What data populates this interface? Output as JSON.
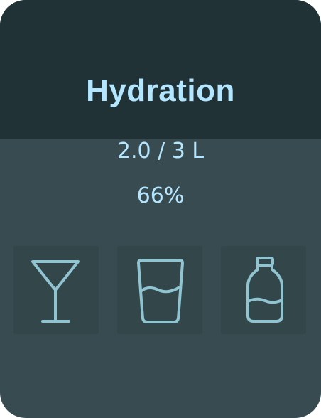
{
  "card": {
    "title": "Hydration",
    "amount": "2.0 / 3 L",
    "percent_text": "66%",
    "progress_fraction": 0.66
  },
  "drinks": [
    {
      "icon": "cocktail-glass-icon"
    },
    {
      "icon": "water-glass-icon"
    },
    {
      "icon": "milk-bottle-icon"
    }
  ],
  "colors": {
    "header_bg": "#213237",
    "body_bg": "#384b50",
    "tile_bg": "#33474b",
    "accent_text": "#b4e6ff",
    "icon_stroke": "#8fc4d0"
  }
}
